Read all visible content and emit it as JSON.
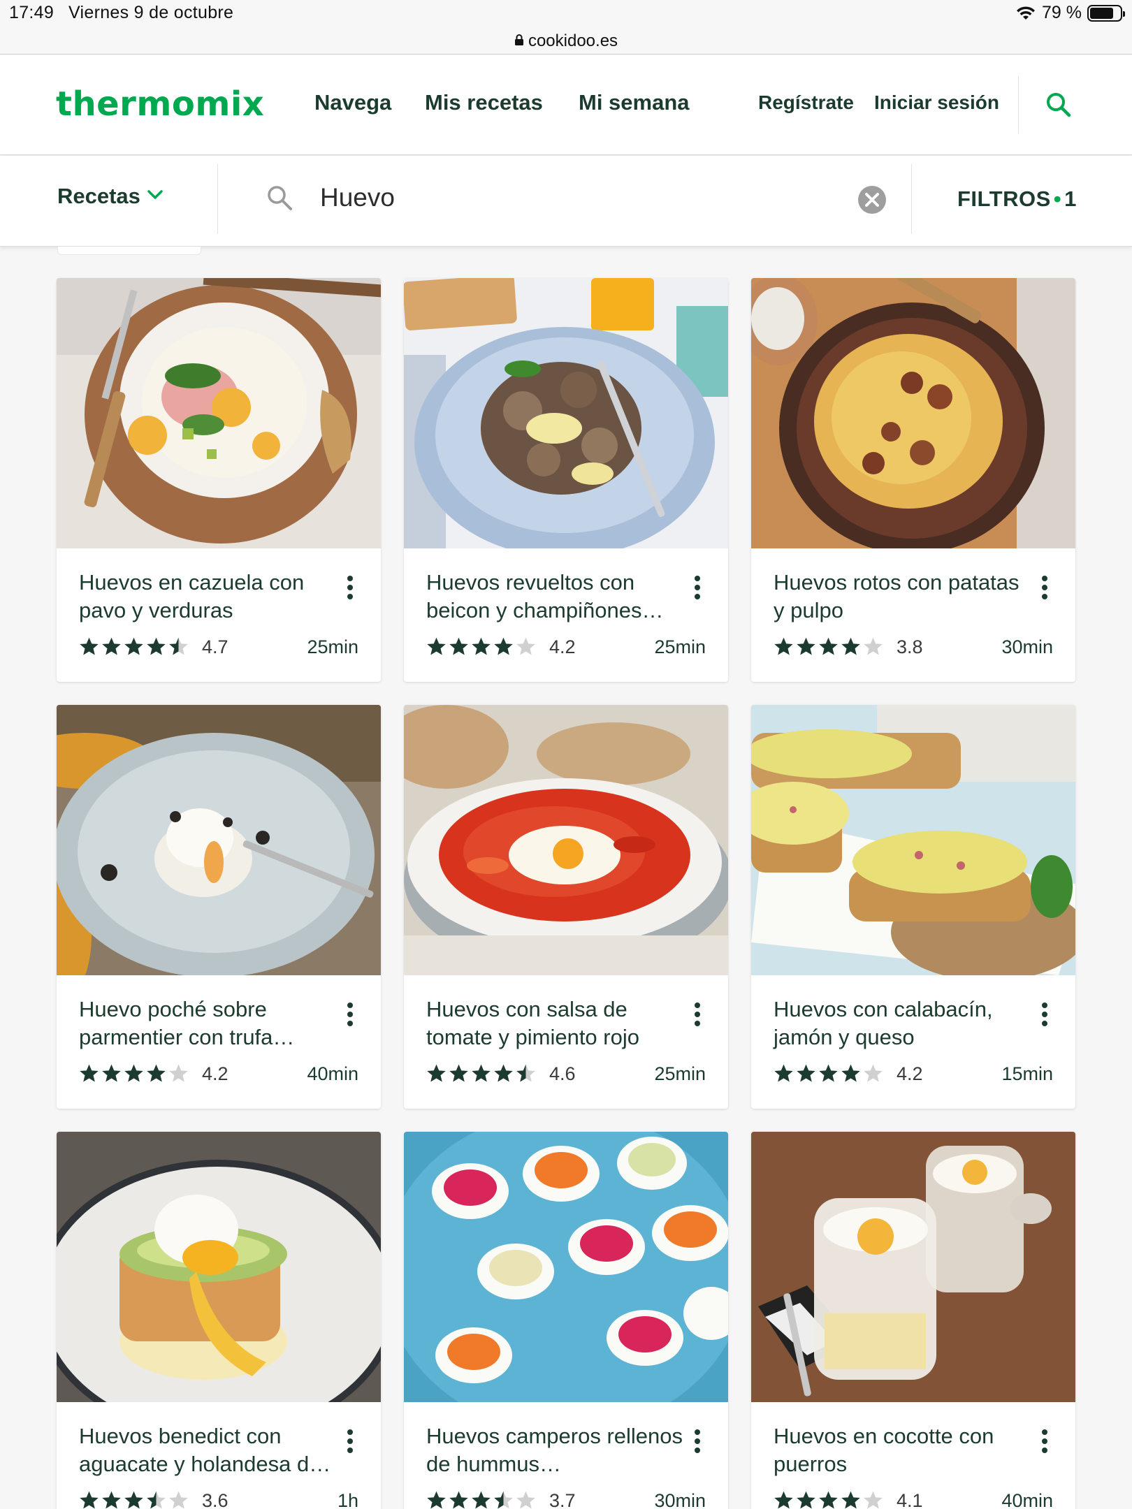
{
  "status_bar": {
    "time": "17:49",
    "date": "Viernes 9 de octubre",
    "battery": "79 %",
    "battery_level": 0.79
  },
  "browser": {
    "url": "cookidoo.es"
  },
  "header": {
    "logo": "thermomix",
    "nav": [
      "Navega",
      "Mis recetas",
      "Mi semana"
    ],
    "register": "Regístrate",
    "login": "Iniciar sesión"
  },
  "search": {
    "category": "Recetas",
    "query": "Huevo",
    "filters_label": "FILTROS",
    "filters_count": "1"
  },
  "colors": {
    "brand_green": "#00a84f",
    "text_dark": "#1b3b2e",
    "star_filled": "#1b3b2e",
    "star_empty": "#d0d0d0"
  },
  "recipes": [
    {
      "title": "Huevos en cazuela con pavo y verduras",
      "rating": "4.7",
      "stars": 4.5,
      "time": "25min"
    },
    {
      "title": "Huevos revueltos con beicon y champiñones…",
      "rating": "4.2",
      "stars": 4,
      "time": "25min"
    },
    {
      "title": "Huevos rotos con patatas y pulpo",
      "rating": "3.8",
      "stars": 4,
      "time": "30min"
    },
    {
      "title": "Huevo poché sobre parmentier con trufa…",
      "rating": "4.2",
      "stars": 4,
      "time": "40min"
    },
    {
      "title": "Huevos con salsa de tomate y pimiento rojo",
      "rating": "4.6",
      "stars": 4.5,
      "time": "25min"
    },
    {
      "title": "Huevos con calabacín, jamón y queso",
      "rating": "4.2",
      "stars": 4,
      "time": "15min"
    },
    {
      "title": "Huevos benedict con aguacate y holandesa d…",
      "rating": "3.6",
      "stars": 3.5,
      "time": "1h"
    },
    {
      "title": "Huevos camperos rellenos de hummus…",
      "rating": "3.7",
      "stars": 3.5,
      "time": "30min"
    },
    {
      "title": "Huevos en cocotte con puerros",
      "rating": "4.1",
      "stars": 4,
      "time": "40min"
    }
  ]
}
